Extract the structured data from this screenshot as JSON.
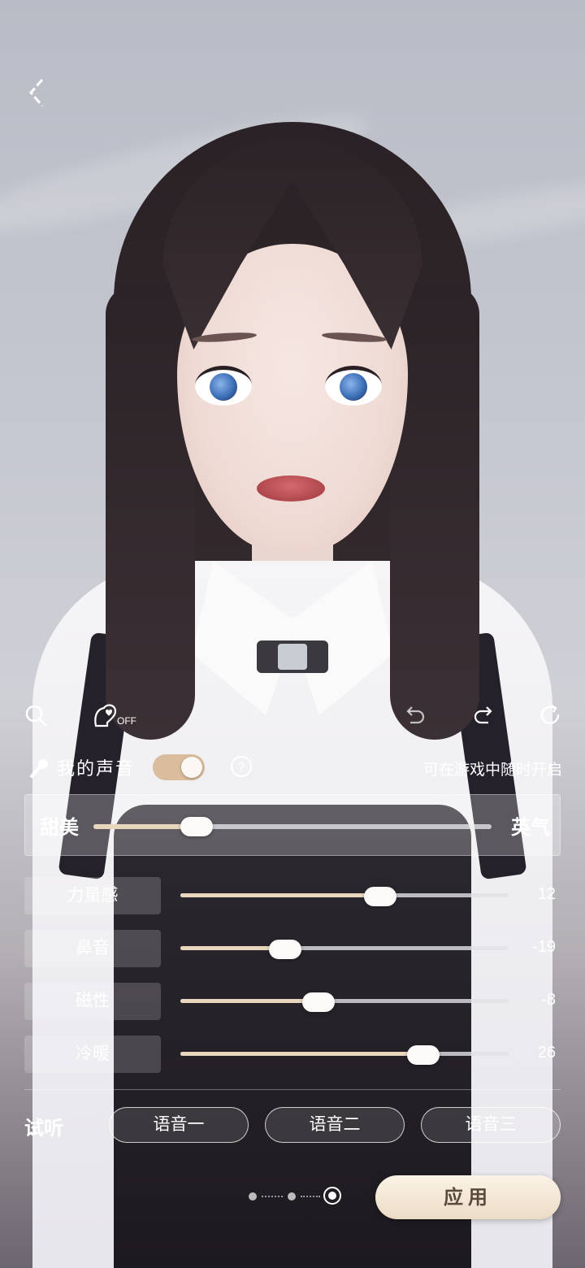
{
  "toolbar": {
    "avatar_effect_state": "OFF"
  },
  "voice": {
    "title": "我的声音",
    "toggle_on": true,
    "help_symbol": "?",
    "hint": "可在游戏中随时开启"
  },
  "main_slider": {
    "left_label": "甜美",
    "right_label": "英气",
    "fill_fraction": 0.26
  },
  "params": [
    {
      "label": "力量感",
      "value": "12",
      "fill_fraction": 0.61
    },
    {
      "label": "鼻音",
      "value": "-19",
      "fill_fraction": 0.32
    },
    {
      "label": "磁性",
      "value": "-8",
      "fill_fraction": 0.42
    },
    {
      "label": "冷暖",
      "value": "26",
      "fill_fraction": 0.74
    }
  ],
  "preview": {
    "label": "试听",
    "buttons": [
      "语音一",
      "语音二",
      "语音三"
    ]
  },
  "pager": {
    "current_page": 3,
    "total_pages": 3
  },
  "apply_label": "应用",
  "colors": {
    "accent": "#e8d6bd",
    "toggle": "#d9bd9c",
    "apply_text": "#5a4a3e"
  },
  "icons": {
    "back": "chevron-left-icon",
    "search": "search-icon",
    "avatar_effect": "heart-head-icon",
    "undo": "undo-icon",
    "redo": "redo-icon",
    "reset": "refresh-icon",
    "mic": "microphone-icon"
  }
}
